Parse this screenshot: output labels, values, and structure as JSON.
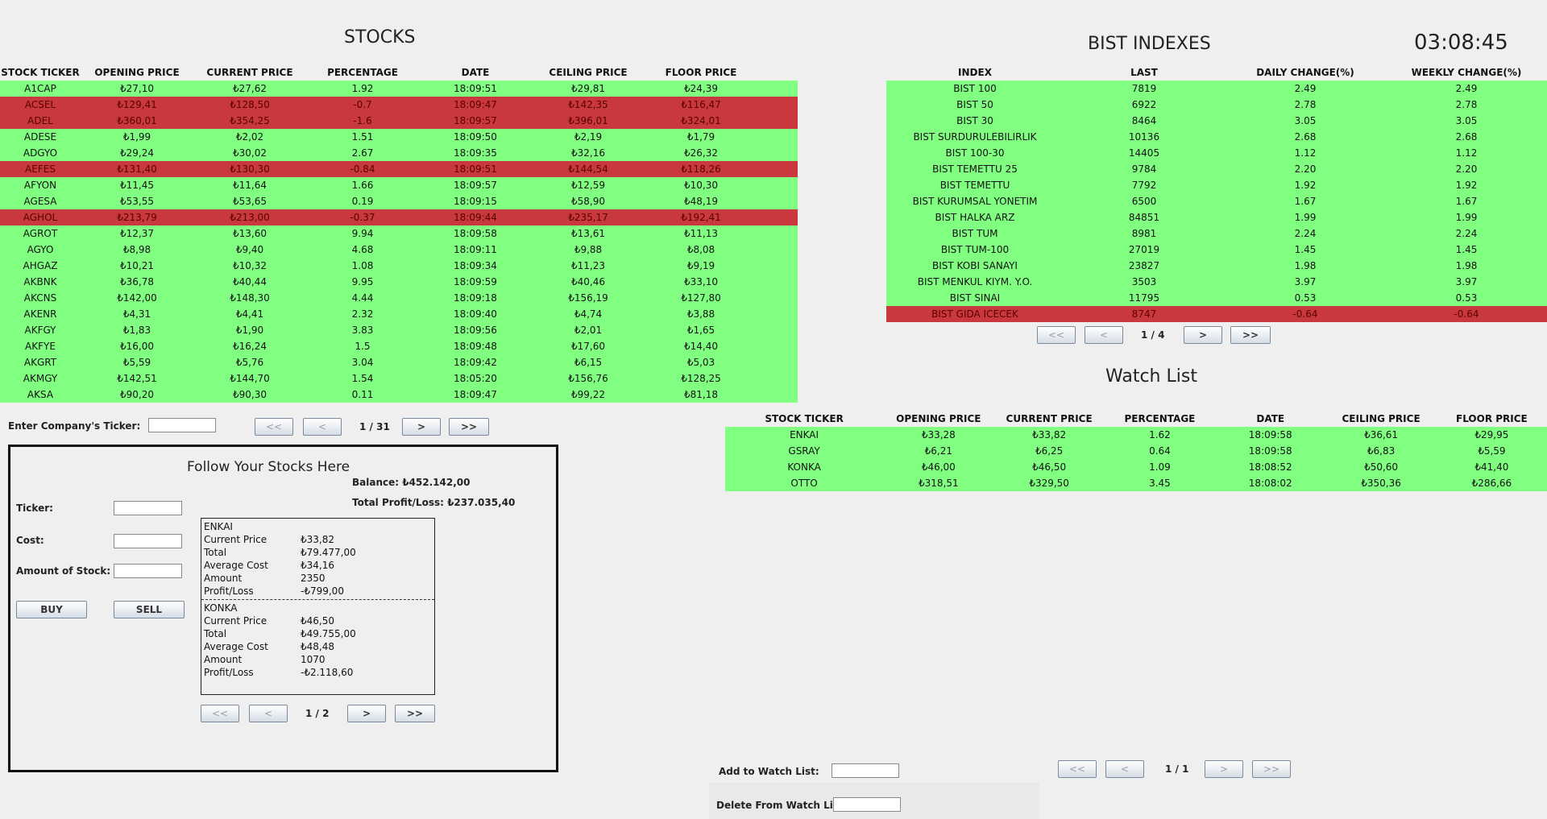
{
  "clock": "03:08:45",
  "stocks": {
    "title": "STOCKS",
    "headers": [
      "STOCK TICKER",
      "OPENING PRICE",
      "CURRENT PRICE",
      "PERCENTAGE",
      "DATE",
      "CEILING PRICE",
      "FLOOR PRICE"
    ],
    "rows": [
      {
        "status": "up",
        "cells": [
          "A1CAP",
          "₺27,10",
          "₺27,62",
          "1.92",
          "18:09:51",
          "₺29,81",
          "₺24,39"
        ]
      },
      {
        "status": "down",
        "cells": [
          "ACSEL",
          "₺129,41",
          "₺128,50",
          "-0.7",
          "18:09:47",
          "₺142,35",
          "₺116,47"
        ]
      },
      {
        "status": "down",
        "cells": [
          "ADEL",
          "₺360,01",
          "₺354,25",
          "-1.6",
          "18:09:57",
          "₺396,01",
          "₺324,01"
        ]
      },
      {
        "status": "up",
        "cells": [
          "ADESE",
          "₺1,99",
          "₺2,02",
          "1.51",
          "18:09:50",
          "₺2,19",
          "₺1,79"
        ]
      },
      {
        "status": "up",
        "cells": [
          "ADGYO",
          "₺29,24",
          "₺30,02",
          "2.67",
          "18:09:35",
          "₺32,16",
          "₺26,32"
        ]
      },
      {
        "status": "down",
        "cells": [
          "AEFES",
          "₺131,40",
          "₺130,30",
          "-0.84",
          "18:09:51",
          "₺144,54",
          "₺118,26"
        ]
      },
      {
        "status": "up",
        "cells": [
          "AFYON",
          "₺11,45",
          "₺11,64",
          "1.66",
          "18:09:57",
          "₺12,59",
          "₺10,30"
        ]
      },
      {
        "status": "up",
        "cells": [
          "AGESA",
          "₺53,55",
          "₺53,65",
          "0.19",
          "18:09:15",
          "₺58,90",
          "₺48,19"
        ]
      },
      {
        "status": "down",
        "cells": [
          "AGHOL",
          "₺213,79",
          "₺213,00",
          "-0.37",
          "18:09:44",
          "₺235,17",
          "₺192,41"
        ]
      },
      {
        "status": "up",
        "cells": [
          "AGROT",
          "₺12,37",
          "₺13,60",
          "9.94",
          "18:09:58",
          "₺13,61",
          "₺11,13"
        ]
      },
      {
        "status": "up",
        "cells": [
          "AGYO",
          "₺8,98",
          "₺9,40",
          "4.68",
          "18:09:11",
          "₺9,88",
          "₺8,08"
        ]
      },
      {
        "status": "up",
        "cells": [
          "AHGAZ",
          "₺10,21",
          "₺10,32",
          "1.08",
          "18:09:34",
          "₺11,23",
          "₺9,19"
        ]
      },
      {
        "status": "up",
        "cells": [
          "AKBNK",
          "₺36,78",
          "₺40,44",
          "9.95",
          "18:09:59",
          "₺40,46",
          "₺33,10"
        ]
      },
      {
        "status": "up",
        "cells": [
          "AKCNS",
          "₺142,00",
          "₺148,30",
          "4.44",
          "18:09:18",
          "₺156,19",
          "₺127,80"
        ]
      },
      {
        "status": "up",
        "cells": [
          "AKENR",
          "₺4,31",
          "₺4,41",
          "2.32",
          "18:09:40",
          "₺4,74",
          "₺3,88"
        ]
      },
      {
        "status": "up",
        "cells": [
          "AKFGY",
          "₺1,83",
          "₺1,90",
          "3.83",
          "18:09:56",
          "₺2,01",
          "₺1,65"
        ]
      },
      {
        "status": "up",
        "cells": [
          "AKFYE",
          "₺16,00",
          "₺16,24",
          "1.5",
          "18:09:48",
          "₺17,60",
          "₺14,40"
        ]
      },
      {
        "status": "up",
        "cells": [
          "AKGRT",
          "₺5,59",
          "₺5,76",
          "3.04",
          "18:09:42",
          "₺6,15",
          "₺5,03"
        ]
      },
      {
        "status": "up",
        "cells": [
          "AKMGY",
          "₺142,51",
          "₺144,70",
          "1.54",
          "18:05:20",
          "₺156,76",
          "₺128,25"
        ]
      },
      {
        "status": "up",
        "cells": [
          "AKSA",
          "₺90,20",
          "₺90,30",
          "0.11",
          "18:09:47",
          "₺99,22",
          "₺81,18"
        ]
      }
    ],
    "ticker_label": "Enter Company's Ticker:",
    "ticker_value": "",
    "pager": {
      "first": "<<",
      "prev": "<",
      "page": "1 / 31",
      "next": ">",
      "last": ">>"
    }
  },
  "indexes": {
    "title": "BIST INDEXES",
    "headers": [
      "INDEX",
      "LAST",
      "DAILY CHANGE(%)",
      "WEEKLY CHANGE(%)"
    ],
    "rows": [
      {
        "status": "up",
        "cells": [
          "BIST 100",
          "7819",
          "2.49",
          "2.49"
        ]
      },
      {
        "status": "up",
        "cells": [
          "BIST 50",
          "6922",
          "2.78",
          "2.78"
        ]
      },
      {
        "status": "up",
        "cells": [
          "BIST 30",
          "8464",
          "3.05",
          "3.05"
        ]
      },
      {
        "status": "up",
        "cells": [
          "BIST SURDURULEBILIRLIK",
          "10136",
          "2.68",
          "2.68"
        ]
      },
      {
        "status": "up",
        "cells": [
          "BIST 100-30",
          "14405",
          "1.12",
          "1.12"
        ]
      },
      {
        "status": "up",
        "cells": [
          "BIST TEMETTU 25",
          "9784",
          "2.20",
          "2.20"
        ]
      },
      {
        "status": "up",
        "cells": [
          "BIST TEMETTU",
          "7792",
          "1.92",
          "1.92"
        ]
      },
      {
        "status": "up",
        "cells": [
          "BIST KURUMSAL YONETIM",
          "6500",
          "1.67",
          "1.67"
        ]
      },
      {
        "status": "up",
        "cells": [
          "BIST HALKA ARZ",
          "84851",
          "1.99",
          "1.99"
        ]
      },
      {
        "status": "up",
        "cells": [
          "BIST TUM",
          "8981",
          "2.24",
          "2.24"
        ]
      },
      {
        "status": "up",
        "cells": [
          "BIST TUM-100",
          "27019",
          "1.45",
          "1.45"
        ]
      },
      {
        "status": "up",
        "cells": [
          "BIST KOBI SANAYI",
          "23827",
          "1.98",
          "1.98"
        ]
      },
      {
        "status": "up",
        "cells": [
          "BIST MENKUL KIYM. Y.O.",
          "3503",
          "3.97",
          "3.97"
        ]
      },
      {
        "status": "up",
        "cells": [
          "BIST SINAI",
          "11795",
          "0.53",
          "0.53"
        ]
      },
      {
        "status": "down",
        "cells": [
          "BIST GIDA ICECEK",
          "8747",
          "-0.64",
          "-0.64"
        ]
      }
    ],
    "pager": {
      "first": "<<",
      "prev": "<",
      "page": "1 / 4",
      "next": ">",
      "last": ">>"
    }
  },
  "watchlist": {
    "title": "Watch List",
    "headers": [
      "STOCK TICKER",
      "OPENING PRICE",
      "CURRENT PRICE",
      "PERCENTAGE",
      "DATE",
      "CEILING PRICE",
      "FLOOR PRICE"
    ],
    "rows": [
      {
        "status": "up",
        "cells": [
          "ENKAI",
          "₺33,28",
          "₺33,82",
          "1.62",
          "18:09:58",
          "₺36,61",
          "₺29,95"
        ]
      },
      {
        "status": "up",
        "cells": [
          "GSRAY",
          "₺6,21",
          "₺6,25",
          "0.64",
          "18:09:58",
          "₺6,83",
          "₺5,59"
        ]
      },
      {
        "status": "up",
        "cells": [
          "KONKA",
          "₺46,00",
          "₺46,50",
          "1.09",
          "18:08:52",
          "₺50,60",
          "₺41,40"
        ]
      },
      {
        "status": "up",
        "cells": [
          "OTTO",
          "₺318,51",
          "₺329,50",
          "3.45",
          "18:08:02",
          "₺350,36",
          "₺286,66"
        ]
      }
    ],
    "add_label": "Add to Watch List:",
    "delete_label": "Delete From Watch List:",
    "pager": {
      "first": "<<",
      "prev": "<",
      "page": "1 / 1",
      "next": ">",
      "last": ">>"
    }
  },
  "portfolio": {
    "title": "Follow Your Stocks Here",
    "balance": "Balance: ₺452.142,00",
    "total_pl": "Total Profit/Loss: ₺237.035,40",
    "ticker_label": "Ticker:",
    "cost_label": "Cost:",
    "amount_label": "Amount of Stock:",
    "buy_label": "BUY",
    "sell_label": "SELL",
    "holdings": [
      {
        "name": "ENKAI",
        "lines": [
          [
            "Current Price",
            "₺33,82"
          ],
          [
            "Total",
            "₺79.477,00"
          ],
          [
            "Average Cost",
            "₺34,16"
          ],
          [
            "Amount",
            "2350"
          ],
          [
            "Profit/Loss",
            "-₺799,00"
          ]
        ]
      },
      {
        "name": "KONKA",
        "lines": [
          [
            "Current Price",
            "₺46,50"
          ],
          [
            "Total",
            "₺49.755,00"
          ],
          [
            "Average Cost",
            "₺48,48"
          ],
          [
            "Amount",
            "1070"
          ],
          [
            "Profit/Loss",
            "-₺2.118,60"
          ]
        ]
      }
    ],
    "pager": {
      "first": "<<",
      "prev": "<",
      "page": "1 / 2",
      "next": ">",
      "last": ">>"
    }
  }
}
